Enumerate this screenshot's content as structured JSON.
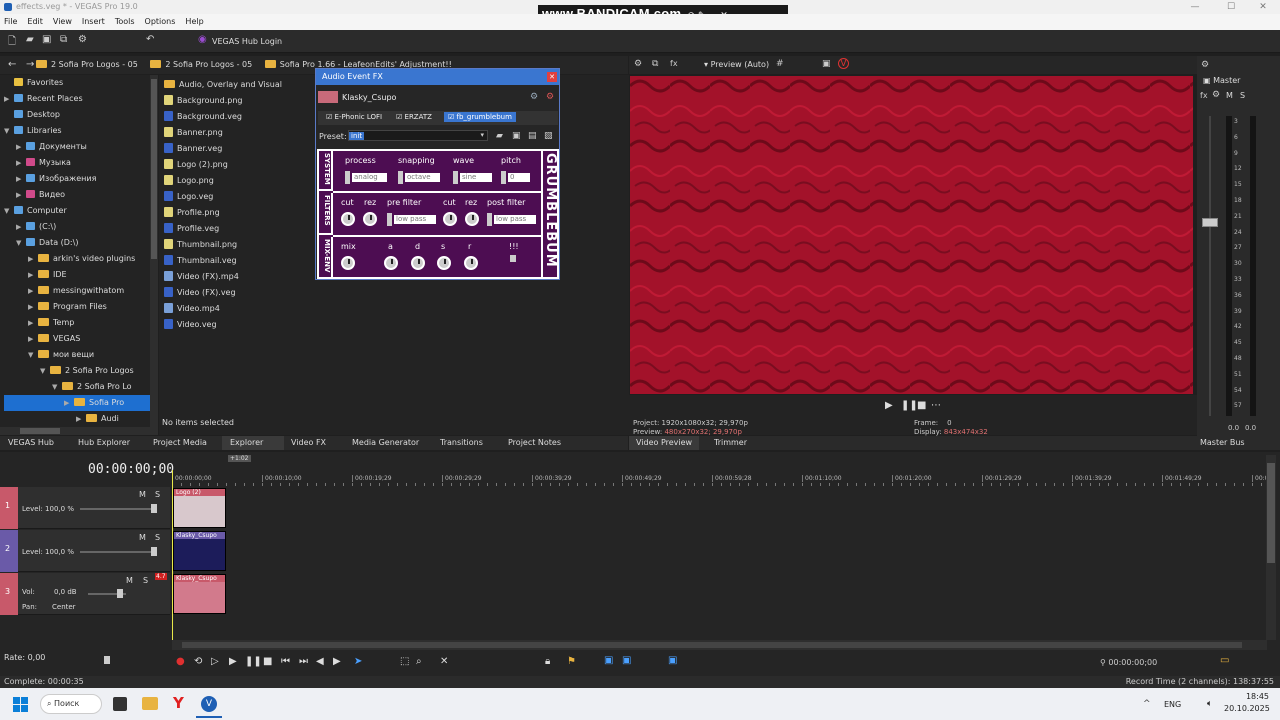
{
  "window": {
    "title": "effects.veg * - VEGAS Pro 19.0",
    "min": "—",
    "max": "☐",
    "close": "✕"
  },
  "bandicam": {
    "text": "www.BANDICAM.com"
  },
  "menu": [
    "File",
    "Edit",
    "View",
    "Insert",
    "Tools",
    "Options",
    "Help"
  ],
  "toolbar": {
    "hub_login": "VEGAS Hub Login"
  },
  "explorer": {
    "breadcrumb": [
      "2 Sofia Pro Logos - 05",
      "2 Sofia Pro Logos - 05",
      "Sofia Pro 1.66 - LeafeonEdits' Adjustment!!"
    ],
    "tree": [
      {
        "label": "Favorites",
        "indent": 0,
        "type": "star"
      },
      {
        "label": "Recent Places",
        "indent": 0,
        "type": "recent"
      },
      {
        "label": "Desktop",
        "indent": 0,
        "type": "desktop"
      },
      {
        "label": "Libraries",
        "indent": 0,
        "type": "lib"
      },
      {
        "label": "Документы",
        "indent": 1,
        "type": "doc"
      },
      {
        "label": "Музыка",
        "indent": 1,
        "type": "music"
      },
      {
        "label": "Изображения",
        "indent": 1,
        "type": "img"
      },
      {
        "label": "Видео",
        "indent": 1,
        "type": "vid"
      },
      {
        "label": "Computer",
        "indent": 0,
        "type": "pc"
      },
      {
        "label": "(C:\\)",
        "indent": 1,
        "type": "drive"
      },
      {
        "label": "Data (D:\\)",
        "indent": 1,
        "type": "drive"
      },
      {
        "label": "arkin's video plugins",
        "indent": 2,
        "type": "folder"
      },
      {
        "label": "IDE",
        "indent": 2,
        "type": "folder"
      },
      {
        "label": "messingwithatom",
        "indent": 2,
        "type": "folder"
      },
      {
        "label": "Program Files",
        "indent": 2,
        "type": "folder"
      },
      {
        "label": "Temp",
        "indent": 2,
        "type": "folder"
      },
      {
        "label": "VEGAS",
        "indent": 2,
        "type": "folder"
      },
      {
        "label": "мои вещи",
        "indent": 2,
        "type": "folder"
      },
      {
        "label": "2 Sofia Pro Logos",
        "indent": 3,
        "type": "folder"
      },
      {
        "label": "2 Sofia Pro Lo",
        "indent": 4,
        "type": "folder"
      },
      {
        "label": "Sofia Pro",
        "indent": 5,
        "type": "folder",
        "selected": true
      },
      {
        "label": "Audi",
        "indent": 6,
        "type": "folder"
      }
    ],
    "files": [
      {
        "name": "Audio, Overlay and Visual",
        "type": "folder"
      },
      {
        "name": "Background.png",
        "type": "png"
      },
      {
        "name": "Background.veg",
        "type": "veg"
      },
      {
        "name": "Banner.png",
        "type": "png"
      },
      {
        "name": "Banner.veg",
        "type": "veg"
      },
      {
        "name": "Logo (2).png",
        "type": "png"
      },
      {
        "name": "Logo.png",
        "type": "png"
      },
      {
        "name": "Logo.veg",
        "type": "veg"
      },
      {
        "name": "Profile.png",
        "type": "png"
      },
      {
        "name": "Profile.veg",
        "type": "veg"
      },
      {
        "name": "Thumbnail.png",
        "type": "png"
      },
      {
        "name": "Thumbnail.veg",
        "type": "veg"
      },
      {
        "name": "Video (FX).mp4",
        "type": "mp4"
      },
      {
        "name": "Video (FX).veg",
        "type": "veg"
      },
      {
        "name": "Video.mp4",
        "type": "mp4"
      },
      {
        "name": "Video.veg",
        "type": "veg"
      }
    ],
    "status": "No items selected"
  },
  "tabs": [
    "VEGAS Hub",
    "Hub Explorer",
    "Project Media",
    "Explorer",
    "Video FX",
    "Media Generator",
    "Transitions",
    "Project Notes"
  ],
  "preview_tabs": [
    "Video Preview",
    "Trimmer"
  ],
  "master_tab": "Master Bus",
  "fx": {
    "title": "Audio Event FX",
    "event": "Klasky_Csupo",
    "chain": [
      "E-Phonic LOFI",
      "ERZATZ",
      "fb_grumblebum"
    ],
    "preset_label": "Preset:",
    "preset_value": "init",
    "plugin_name": "GRUMBLEBUM",
    "section_system": "SYSTEM",
    "section_filters": "FILTERS",
    "section_mixenv": "MIX-ENV",
    "system_labels": [
      "process",
      "snapping",
      "wave",
      "pitch"
    ],
    "system_values": [
      "analog",
      "octave",
      "sine",
      "0"
    ],
    "filter_labels": [
      "cut",
      "rez",
      "pre filter",
      "cut",
      "rez",
      "post filter"
    ],
    "filter_values": [
      "low pass",
      "low pass"
    ],
    "env_labels": [
      "mix",
      "a",
      "d",
      "s",
      "r",
      "!!!"
    ]
  },
  "preview": {
    "mode": "Preview (Auto)",
    "project_label": "Project:",
    "project_value": "1920x1080x32; 29,970p",
    "preview_label": "Preview:",
    "preview_value": "480x270x32; 29,970p",
    "frame_label": "Frame:",
    "frame_value": "0",
    "display_label": "Display:",
    "display_value": "843x474x32"
  },
  "master": {
    "title": "Master",
    "m": "M",
    "s": "S",
    "scale": [
      "3",
      "6",
      "9",
      "12",
      "15",
      "18",
      "21",
      "24",
      "27",
      "30",
      "33",
      "36",
      "39",
      "42",
      "45",
      "48",
      "51",
      "54",
      "57"
    ],
    "left": "0.0",
    "right": "0.0"
  },
  "timeline": {
    "timecode": "00:00:00;00",
    "marker": "+1:02",
    "ticks": [
      "00:00:00;00",
      "00:00:10;00",
      "00:00:19;29",
      "00:00:29;29",
      "00:00:39;29",
      "00:00:49;29",
      "00:00:59;28",
      "00:01:10;00",
      "00:01:20;00",
      "00:01:29;29",
      "00:01:39;29",
      "00:01:49;29",
      "00:01"
    ],
    "tracks": [
      {
        "num": "1",
        "label": "Level: 100,0 %",
        "m": "M",
        "s": "S",
        "color": "#c8596a",
        "clip": "Logo (2)"
      },
      {
        "num": "2",
        "label": "Level: 100,0 %",
        "m": "M",
        "s": "S",
        "color": "#6a5aa8",
        "clip": "Klasky_Csupo"
      },
      {
        "num": "3",
        "vol": "Vol:",
        "vol_value": "0,0 dB",
        "pan": "Pan:",
        "pan_value": "Center",
        "m": "M",
        "s": "S",
        "color": "#c8596a",
        "clip": "Klasky_Csupo",
        "peak": "4.7"
      }
    ],
    "rate": "Rate: 0,00",
    "end_timecode": "00:00:00;00"
  },
  "status": {
    "left": "Complete: 00:00:35",
    "right": "Record Time (2 channels): 138:37:55"
  },
  "taskbar": {
    "search": "Поиск",
    "lang": "ENG",
    "time": "18:45",
    "date": "20.10.2025"
  }
}
